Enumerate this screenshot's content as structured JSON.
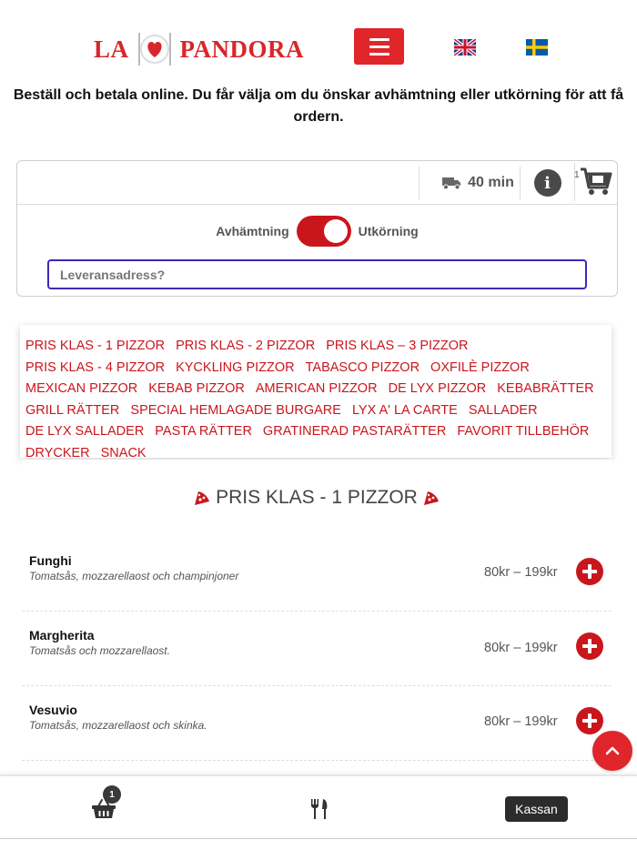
{
  "header": {
    "logo_left": "LA",
    "logo_right": "PANDORA",
    "menu_icon": "hamburger-icon",
    "languages": [
      {
        "code": "en",
        "icon": "uk-flag-icon"
      },
      {
        "code": "sv",
        "icon": "sweden-flag-icon"
      }
    ]
  },
  "intro_text": "Beställ och betala online. Du får välja om du önskar avhämtning eller utkörning för att få ordern.",
  "delivery": {
    "time": "40 min",
    "truck_icon": "truck-icon",
    "info_icon": "info-icon",
    "cart_icon": "cart-icon",
    "cart_count": "1",
    "pickup_label": "Avhämtning",
    "delivery_label": "Utkörning",
    "mode_delivery_selected": true,
    "address_placeholder": "Leveransadress?"
  },
  "categories": [
    "PRIS KLAS - 1 PIZZOR",
    "PRIS KLAS - 2 PIZZOR",
    "PRIS KLAS – 3 PIZZOR",
    "PRIS KLAS - 4 PIZZOR",
    "KYCKLING PIZZOR",
    "TABASCO PIZZOR",
    "OXFILÈ PIZZOR",
    "MEXICAN PIZZOR",
    "KEBAB PIZZOR",
    "AMERICAN PIZZOR",
    "DE LYX PIZZOR",
    "KEBABRÄTTER",
    "GRILL RÄTTER",
    "SPECIAL HEMLAGADE BURGARE",
    "LYX A' LA CARTE",
    "SALLADER",
    "DE LYX SALLADER",
    "PASTA RÄTTER",
    "GRATINERAD PASTARÄTTER",
    "FAVORIT TILLBEHÖR",
    "DRYCKER",
    "SNACK"
  ],
  "menu": {
    "section_title": "PRIS KLAS - 1 PIZZOR",
    "section_icon": "pizza-slice-icon",
    "items": [
      {
        "name": "Funghi",
        "desc": "Tomatsås, mozzarellaost och champinjoner",
        "price": "80kr – 199kr"
      },
      {
        "name": "Margherita",
        "desc": "Tomatsås och mozzarellaost.",
        "price": "80kr – 199kr"
      },
      {
        "name": "Vesuvio",
        "desc": "Tomatsås, mozzarellaost och skinka.",
        "price": "80kr – 199kr"
      }
    ]
  },
  "bottom_bar": {
    "basket_icon": "basket-icon",
    "basket_count": "1",
    "menu_icon": "cutlery-icon",
    "checkout_label": "Kassan"
  },
  "colors": {
    "brand_red": "#c9161c",
    "accent_red": "#e0252b",
    "address_border": "#3a2bb5"
  }
}
